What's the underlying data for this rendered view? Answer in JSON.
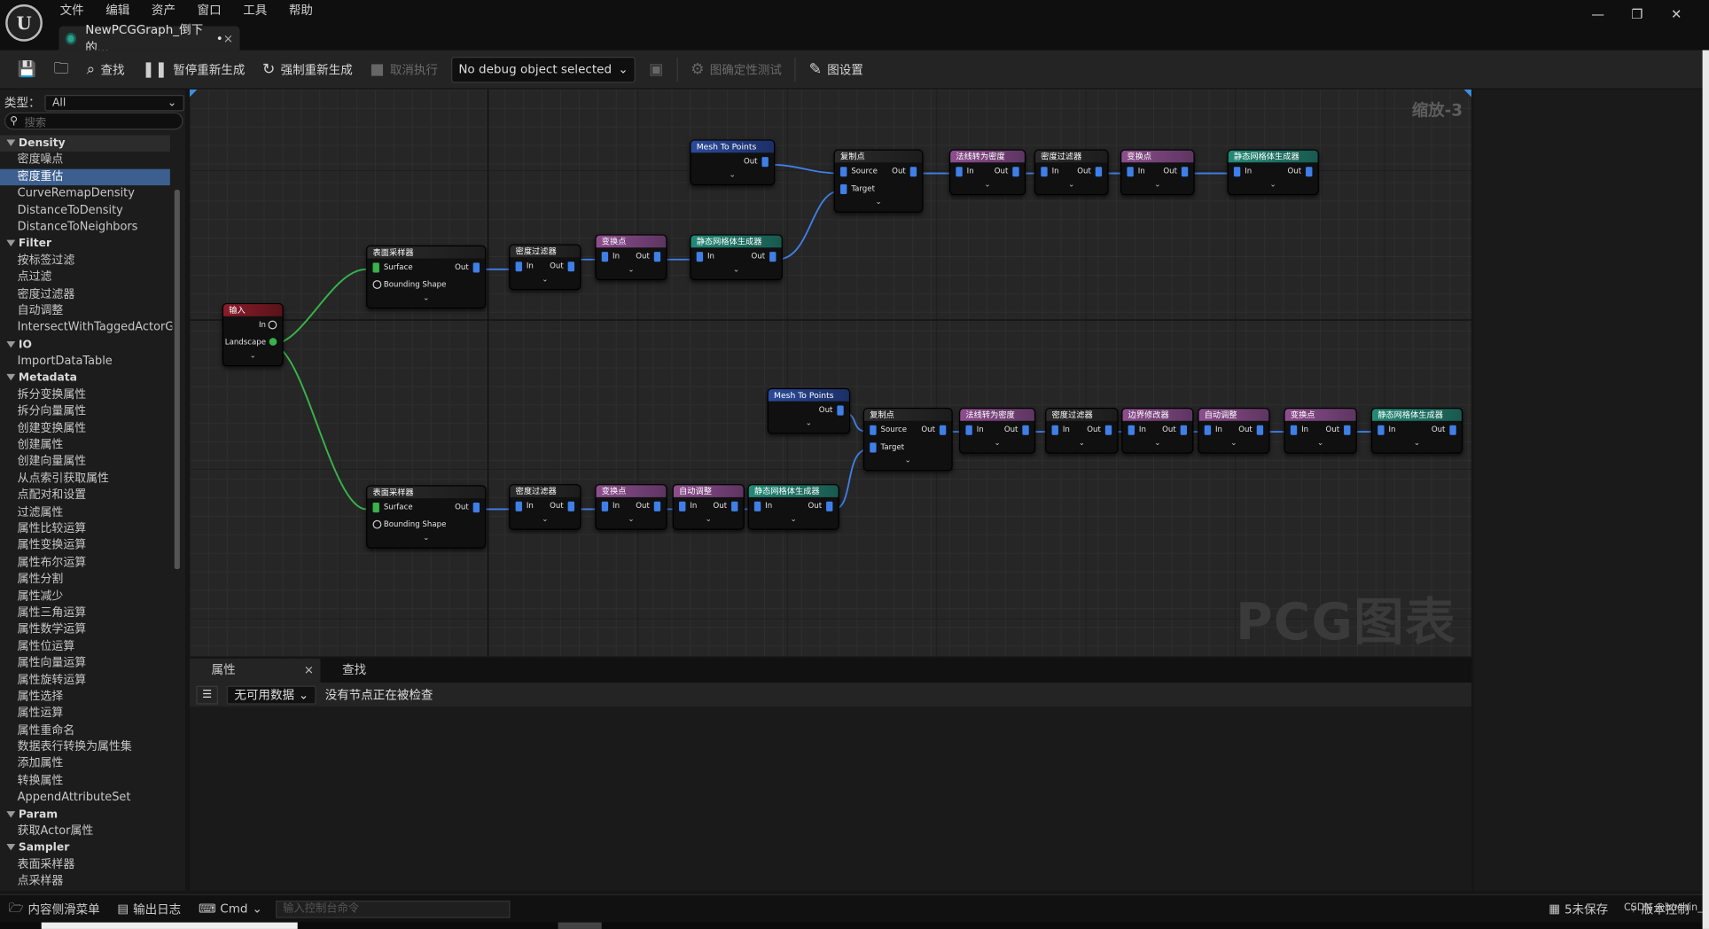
{
  "menu": [
    "文件",
    "编辑",
    "资产",
    "窗口",
    "工具",
    "帮助"
  ],
  "doc_tab": {
    "title": "NewPCGGraph_倒下的...",
    "modified": "•",
    "close": "×"
  },
  "window_controls": {
    "minimize": "—",
    "restore": "❐",
    "close": "✕"
  },
  "toolbar": {
    "find": "查找",
    "pause_regen": "暂停重新生成",
    "force_regen": "强制重新生成",
    "cancel_exec": "取消执行",
    "debug_object": "No debug object selected",
    "determinism": "图确定性测试",
    "graph_settings": "图设置"
  },
  "palette": {
    "type_label": "类型：",
    "type_value": "All",
    "search_placeholder": "搜索",
    "tree": [
      {
        "category": "Density",
        "items": [
          "密度噪点",
          "密度重估",
          "CurveRemapDensity",
          "DistanceToDensity",
          "DistanceToNeighbors"
        ]
      },
      {
        "category": "Filter",
        "items": [
          "按标签过滤",
          "点过滤",
          "密度过滤器",
          "自动调整",
          "IntersectWithTaggedActorGeo"
        ]
      },
      {
        "category": "IO",
        "items": [
          "ImportDataTable"
        ]
      },
      {
        "category": "Metadata",
        "items": [
          "拆分变换属性",
          "拆分向量属性",
          "创建变换属性",
          "创建属性",
          "创建向量属性",
          "从点索引获取属性",
          "点配对和设置",
          "过滤属性",
          "属性比较运算",
          "属性变换运算",
          "属性布尔运算",
          "属性分割",
          "属性减少",
          "属性三角运算",
          "属性数学运算",
          "属性位运算",
          "属性向量运算",
          "属性旋转运算",
          "属性选择",
          "属性运算",
          "属性重命名",
          "数据表行转换为属性集",
          "添加属性",
          "转换属性",
          "AppendAttributeSet"
        ]
      },
      {
        "category": "Param",
        "items": [
          "获取Actor属性"
        ]
      },
      {
        "category": "Sampler",
        "items": [
          "表面采样器",
          "点采样器"
        ]
      }
    ],
    "selected": "密度重估"
  },
  "graph": {
    "zoom": "缩放-3",
    "watermark": "PCG图表",
    "nodes": {
      "input": {
        "title": "输入",
        "pin_in": "In",
        "pin_landscape": "Landscape"
      },
      "sampler1": {
        "title": "表面采样器",
        "surface": "Surface",
        "out": "Out",
        "bounding": "Bounding Shape"
      },
      "sampler2": {
        "title": "表面采样器",
        "surface": "Surface",
        "out": "Out",
        "bounding": "Bounding Shape"
      },
      "densfilt1": {
        "title": "密度过滤器",
        "in": "In",
        "out": "Out"
      },
      "transform1": {
        "title": "变换点",
        "in": "In",
        "out": "Out"
      },
      "spawner1": {
        "title": "静态网格体生成器",
        "in": "In",
        "out": "Out"
      },
      "meshpts1": {
        "title": "Mesh To Points",
        "out": "Out"
      },
      "copy1": {
        "title": "复制点",
        "source": "Source",
        "out": "Out",
        "target": "Target"
      },
      "normal1": {
        "title": "法线转为密度",
        "in": "In",
        "out": "Out"
      },
      "densfilt2": {
        "title": "密度过滤器",
        "in": "In",
        "out": "Out"
      },
      "transform2": {
        "title": "变换点",
        "in": "In",
        "out": "Out"
      },
      "spawner2": {
        "title": "静态网格体生成器",
        "in": "In",
        "out": "Out"
      },
      "densfilt3": {
        "title": "密度过滤器",
        "in": "In",
        "out": "Out"
      },
      "transform3": {
        "title": "变换点",
        "in": "In",
        "out": "Out"
      },
      "autoadj1": {
        "title": "自动调整",
        "in": "In",
        "out": "Out"
      },
      "spawner3": {
        "title": "静态网格体生成器",
        "in": "In",
        "out": "Out"
      },
      "meshpts2": {
        "title": "Mesh To Points",
        "out": "Out"
      },
      "copy2": {
        "title": "复制点",
        "source": "Source",
        "out": "Out",
        "target": "Target"
      },
      "normal2": {
        "title": "法线转为密度",
        "in": "In",
        "out": "Out"
      },
      "densfilt4": {
        "title": "密度过滤器",
        "in": "In",
        "out": "Out"
      },
      "edgemod": {
        "title": "边界修改器",
        "in": "In",
        "out": "Out"
      },
      "autoadj2": {
        "title": "自动调整",
        "in": "In",
        "out": "Out"
      },
      "transform4": {
        "title": "变换点",
        "in": "In",
        "out": "Out"
      },
      "spawner4": {
        "title": "静态网格体生成器",
        "in": "In",
        "out": "Out"
      }
    }
  },
  "bottom_panel": {
    "tab_properties": "属性",
    "tab_close": "×",
    "tab_find": "查找",
    "data_select": "无可用数据",
    "status_text": "没有节点正在被检查"
  },
  "statusbar": {
    "content_drawer": "内容侧滑菜单",
    "output_log": "输出日志",
    "cmd": "Cmd",
    "console_placeholder": "输入控制台命令",
    "unsaved": "5未保存",
    "source_control": "版本控制"
  },
  "credit": "CSDN @hochin_"
}
